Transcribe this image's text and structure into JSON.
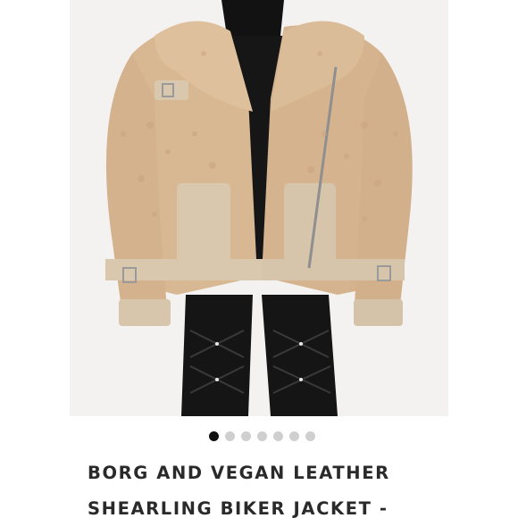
{
  "product": {
    "title_lines": [
      "BORG AND VEGAN LEATHER",
      "SHEARLING BIKER JACKET -"
    ],
    "image_alt": "Tan borg and vegan leather shearling biker jacket worn by model",
    "photo_background": "#f4f2f0"
  },
  "carousel": {
    "total": 7,
    "active_index": 0
  },
  "colors": {
    "jacket": "#d9b896",
    "leather": "#d8c6ae",
    "dark": "#111111",
    "dot_active": "#111111",
    "dot_inactive": "#cfcfcf"
  }
}
